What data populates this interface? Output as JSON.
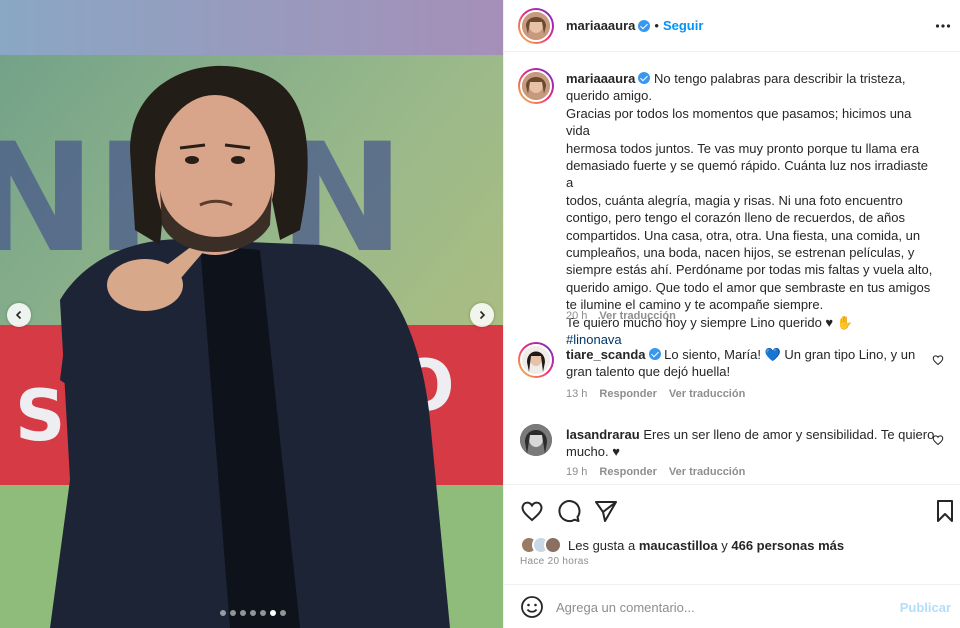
{
  "post": {
    "carousel_dots": 7,
    "carousel_active_index": 5
  },
  "header": {
    "username": "mariaaaura",
    "separator": "•",
    "follow_label": "Seguir",
    "more_icon": "more-horizontal-icon"
  },
  "caption": {
    "username": "mariaaaura",
    "text_lines": [
      "No tengo palabras para describir la tristeza,",
      "querido amigo.",
      "Gracias por todos los momentos que pasamos; hicimos una vida",
      "hermosa todos juntos. Te vas muy pronto porque tu llama era",
      "demasiado fuerte y se quemó rápido. Cuánta luz nos irradiaste a",
      "todos, cuánta alegría, magia y risas. Ni una foto encuentro",
      "contigo, pero tengo el corazón lleno de recuerdos, de años",
      "compartidos. Una casa, otra, otra. Una fiesta, una comida, un",
      "cumpleaños, una boda, nacen hijos, se estrenan películas, y",
      "siempre estás ahí. Perdóname por todas mis faltas y vuela alto,",
      "querido amigo. Que todo el amor que sembraste en tus amigos",
      "te ilumine el camino y te acompañe siempre.",
      "Te quiero mucho hoy y siempre Lino querido ♥ ✋"
    ],
    "hashtag": "#linonava",
    "time": "20 h",
    "translate_label": "Ver traducción"
  },
  "comments": [
    {
      "username": "tiare_scanda",
      "verified": true,
      "line1": "Lo siento, María! 💙 Un gran tipo Lino, y un",
      "line2": "gran talento que dejó huella!",
      "time": "13 h",
      "reply_label": "Responder",
      "translate_label": "Ver traducción"
    },
    {
      "username": "lasandrarau",
      "verified": false,
      "line1": "Eres un ser lleno de amor y sensibilidad. Te quiero",
      "line2": "mucho. ♥",
      "time": "19 h",
      "reply_label": "Responder",
      "translate_label": "Ver traducción"
    }
  ],
  "likes": {
    "prefix": "Les gusta a",
    "user": "maucastilloa",
    "connector": "y",
    "others": "466 personas más"
  },
  "posted_ago": "Hace 20 horas",
  "add_comment": {
    "placeholder": "Agrega un comentario...",
    "publish_label": "Publicar"
  },
  "colors": {
    "accent": "#0095f6",
    "verified": "#3897f0",
    "muted": "#8e8e8e",
    "text": "#262626"
  }
}
